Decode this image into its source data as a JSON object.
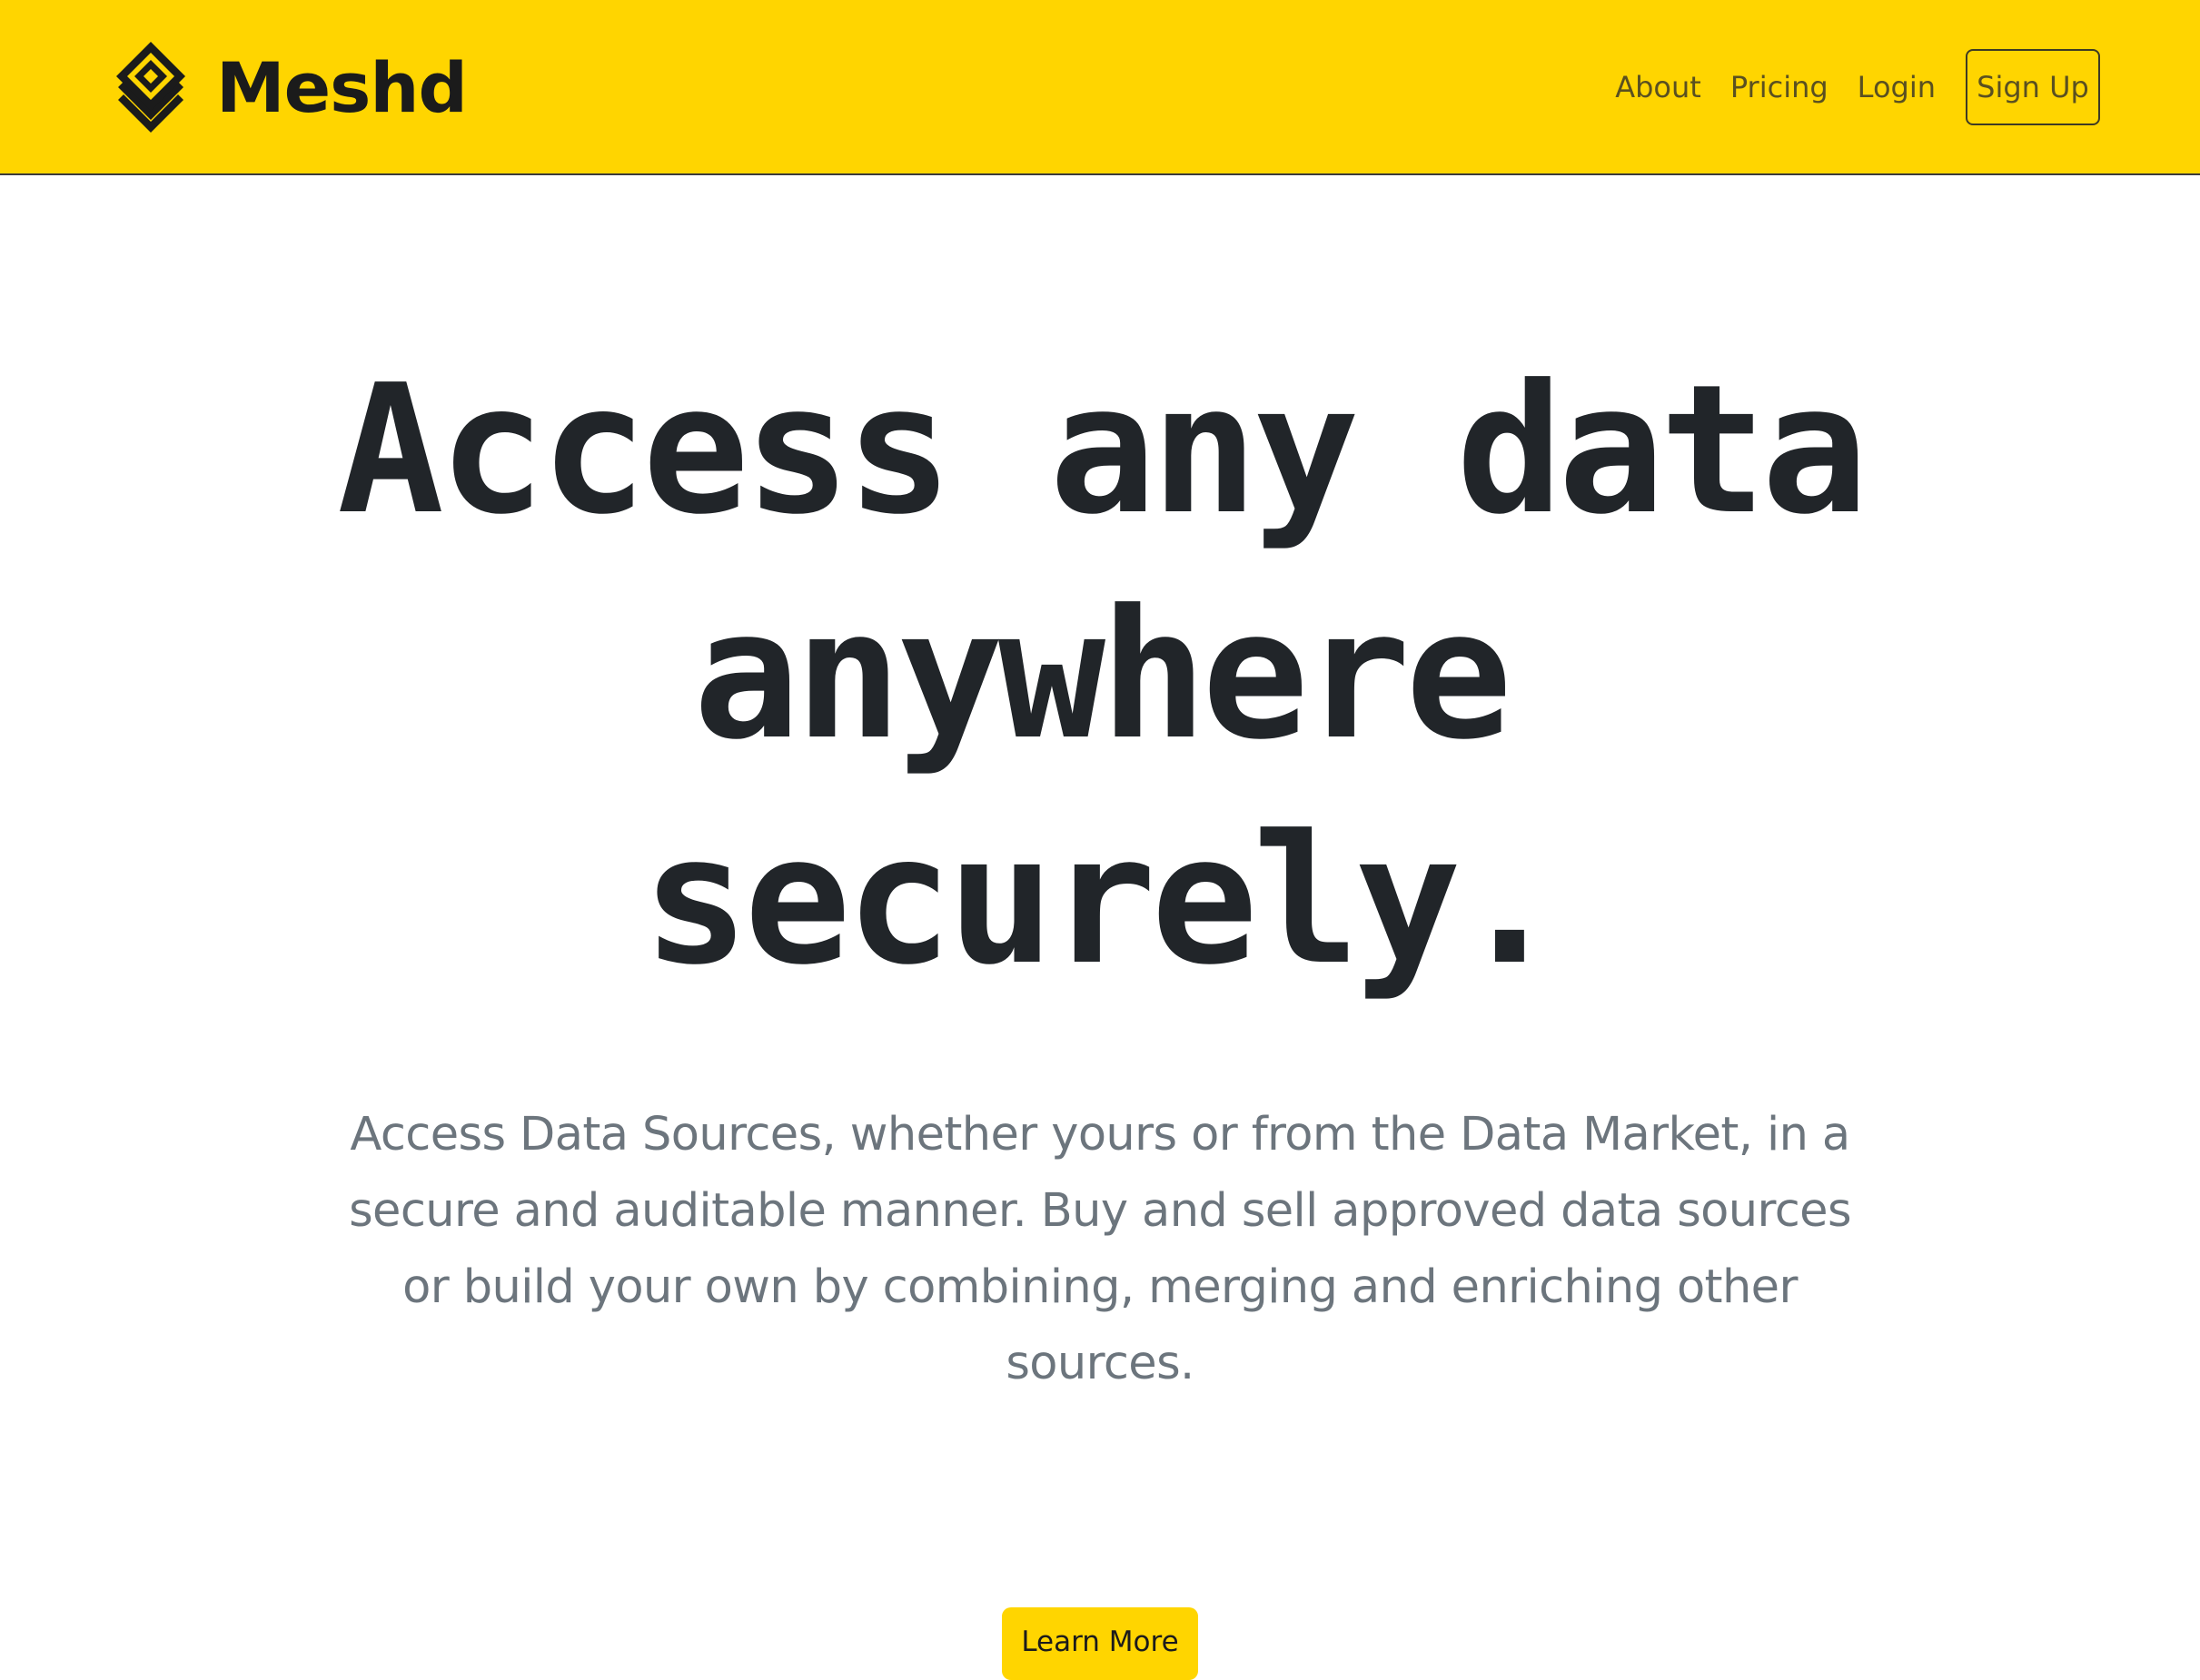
{
  "navbar": {
    "brand_name": "Meshd",
    "logo_icon": "layered-diamond-logo-icon",
    "links": [
      {
        "label": "About"
      },
      {
        "label": "Pricing"
      },
      {
        "label": "Login"
      }
    ],
    "signup_label": "Sign Up",
    "background_color": "#ffd500"
  },
  "hero": {
    "title_line1": "Access any data",
    "title_line2": "anywhere",
    "title_line3": "securely.",
    "description": "Access Data Sources, whether yours or from the Data Market, in a secure and auditable manner. Buy and sell approved data sources or build your own by combining, merging and enriching other sources.",
    "cta_label": "Learn More"
  }
}
